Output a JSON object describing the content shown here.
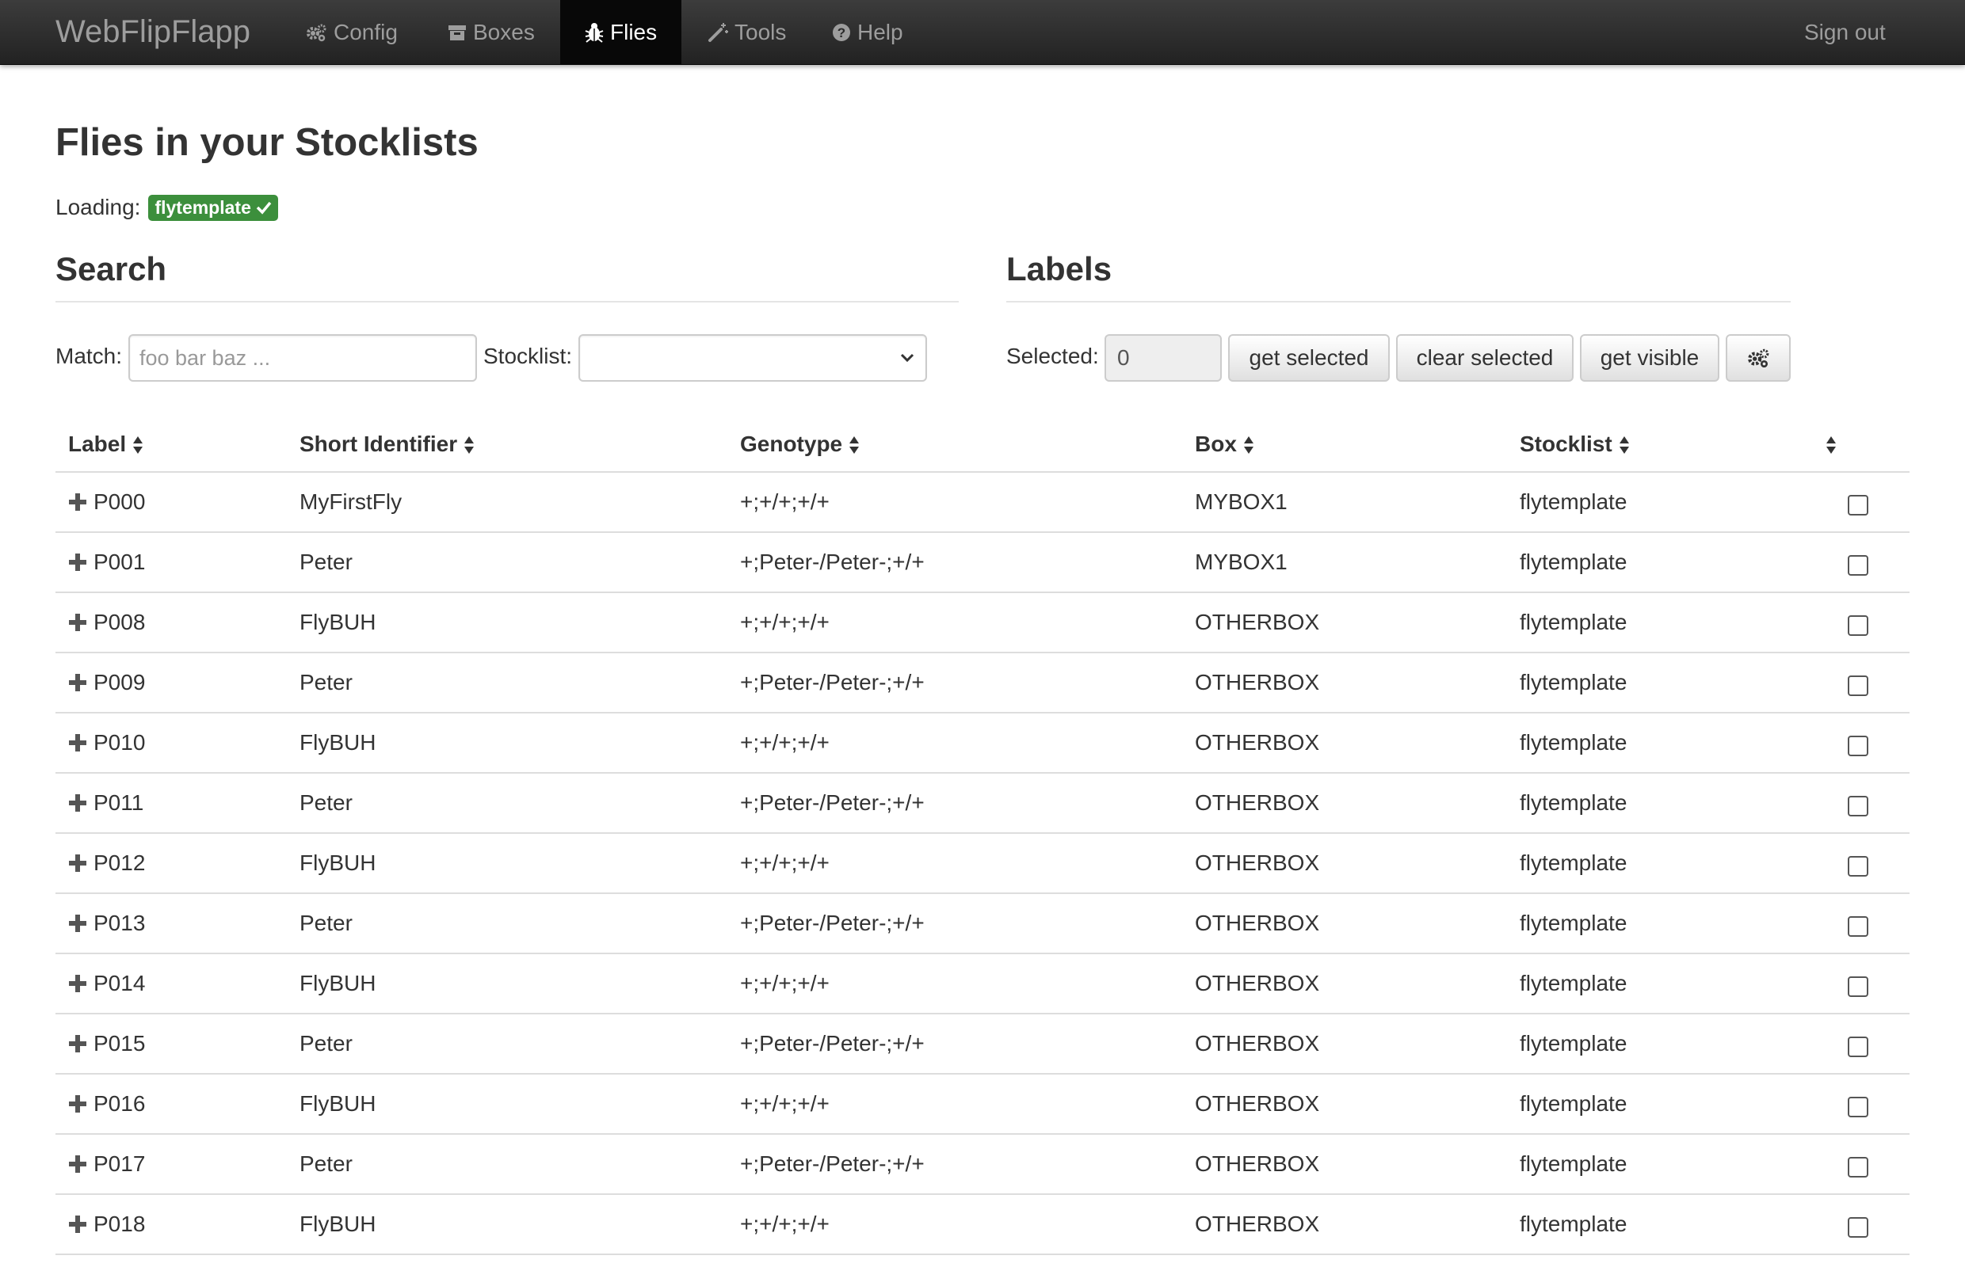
{
  "navbar": {
    "brand": "WebFlipFlapp",
    "items": [
      {
        "label": "Config",
        "icon": "cogs-icon"
      },
      {
        "label": "Boxes",
        "icon": "archive-icon"
      },
      {
        "label": "Flies",
        "icon": "bug-icon",
        "active": true
      },
      {
        "label": "Tools",
        "icon": "magic-wand-icon"
      },
      {
        "label": "Help",
        "icon": "question-circle-icon"
      }
    ],
    "signout": "Sign out"
  },
  "page": {
    "title": "Flies in your Stocklists",
    "loading_label": "Loading:",
    "loading_badge": "flytemplate"
  },
  "search": {
    "heading": "Search",
    "match_label": "Match:",
    "match_placeholder": "foo bar baz ...",
    "match_value": "",
    "stocklist_label": "Stocklist:",
    "stocklist_value": ""
  },
  "labels": {
    "heading": "Labels",
    "selected_label": "Selected:",
    "selected_value": "0",
    "get_selected": "get selected",
    "clear_selected": "clear selected",
    "get_visible": "get visible",
    "settings_icon": "cogs-icon"
  },
  "table": {
    "headers": {
      "label": "Label",
      "short": "Short Identifier",
      "genotype": "Genotype",
      "box": "Box",
      "stocklist": "Stocklist"
    },
    "rows": [
      {
        "label": "P000",
        "short": "MyFirstFly",
        "genotype": "+;+/+;+/+",
        "box": "MYBOX1",
        "stocklist": "flytemplate"
      },
      {
        "label": "P001",
        "short": "Peter",
        "genotype": "+;Peter-/Peter-;+/+",
        "box": "MYBOX1",
        "stocklist": "flytemplate"
      },
      {
        "label": "P008",
        "short": "FlyBUH",
        "genotype": "+;+/+;+/+",
        "box": "OTHERBOX",
        "stocklist": "flytemplate"
      },
      {
        "label": "P009",
        "short": "Peter",
        "genotype": "+;Peter-/Peter-;+/+",
        "box": "OTHERBOX",
        "stocklist": "flytemplate"
      },
      {
        "label": "P010",
        "short": "FlyBUH",
        "genotype": "+;+/+;+/+",
        "box": "OTHERBOX",
        "stocklist": "flytemplate"
      },
      {
        "label": "P011",
        "short": "Peter",
        "genotype": "+;Peter-/Peter-;+/+",
        "box": "OTHERBOX",
        "stocklist": "flytemplate"
      },
      {
        "label": "P012",
        "short": "FlyBUH",
        "genotype": "+;+/+;+/+",
        "box": "OTHERBOX",
        "stocklist": "flytemplate"
      },
      {
        "label": "P013",
        "short": "Peter",
        "genotype": "+;Peter-/Peter-;+/+",
        "box": "OTHERBOX",
        "stocklist": "flytemplate"
      },
      {
        "label": "P014",
        "short": "FlyBUH",
        "genotype": "+;+/+;+/+",
        "box": "OTHERBOX",
        "stocklist": "flytemplate"
      },
      {
        "label": "P015",
        "short": "Peter",
        "genotype": "+;Peter-/Peter-;+/+",
        "box": "OTHERBOX",
        "stocklist": "flytemplate"
      },
      {
        "label": "P016",
        "short": "FlyBUH",
        "genotype": "+;+/+;+/+",
        "box": "OTHERBOX",
        "stocklist": "flytemplate"
      },
      {
        "label": "P017",
        "short": "Peter",
        "genotype": "+;Peter-/Peter-;+/+",
        "box": "OTHERBOX",
        "stocklist": "flytemplate"
      },
      {
        "label": "P018",
        "short": "FlyBUH",
        "genotype": "+;+/+;+/+",
        "box": "OTHERBOX",
        "stocklist": "flytemplate"
      }
    ]
  },
  "colors": {
    "navbar_bg": "#222222",
    "navbar_active_bg": "#080808",
    "badge_success": "#3c8f3c",
    "text": "#333333"
  }
}
